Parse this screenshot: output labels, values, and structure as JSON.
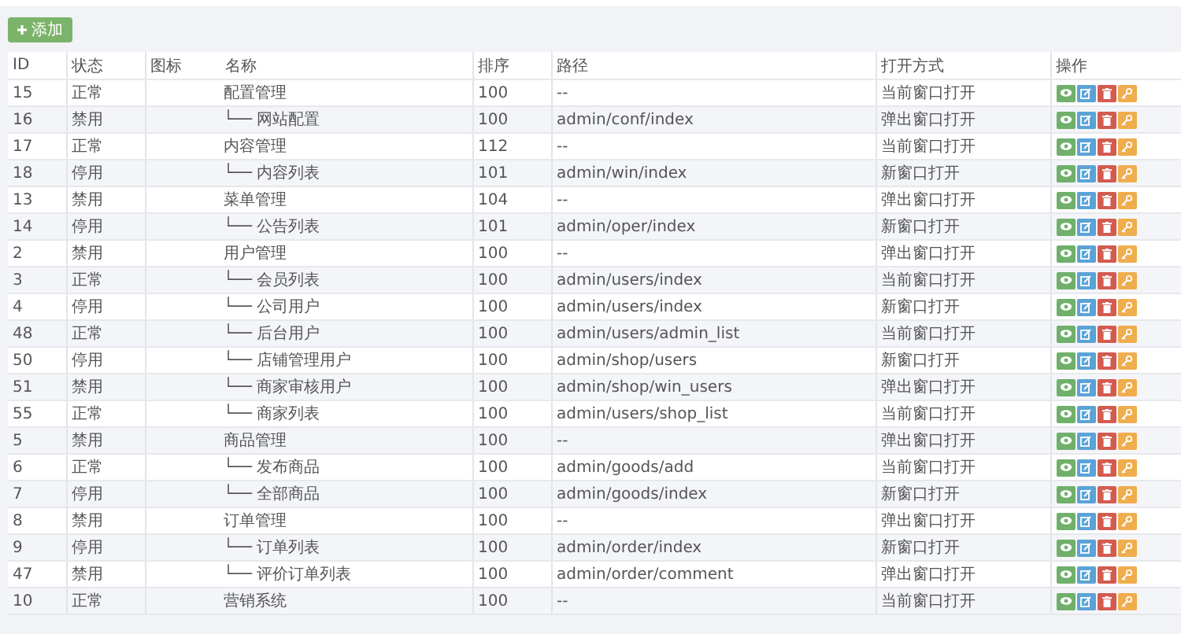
{
  "toolbar": {
    "add_button": "添加"
  },
  "table": {
    "columns": [
      "ID",
      "状态",
      "图标",
      "名称",
      "排序",
      "路径",
      "打开方式",
      "操作"
    ],
    "rows": [
      {
        "id": "15",
        "status": "正常",
        "name": "配置管理",
        "sort": "100",
        "path": "--",
        "open": "当前窗口打开",
        "children": [
          {
            "id": "16",
            "status": "禁用",
            "name": "└── 网站配置",
            "sort": "100",
            "path": "admin/conf/index",
            "open": "弹出窗口打开"
          }
        ]
      },
      {
        "id": "17",
        "status": "正常",
        "name": "内容管理",
        "sort": "112",
        "path": "--",
        "open": "当前窗口打开",
        "children": [
          {
            "id": "18",
            "status": "停用",
            "name": "└── 内容列表",
            "sort": "101",
            "path": "admin/win/index",
            "open": "新窗口打开"
          }
        ]
      },
      {
        "id": "13",
        "status": "禁用",
        "name": "菜单管理",
        "sort": "104",
        "path": "--",
        "open": "弹出窗口打开",
        "children": [
          {
            "id": "14",
            "status": "停用",
            "name": "└── 公告列表",
            "sort": "101",
            "path": "admin/oper/index",
            "open": "新窗口打开"
          }
        ]
      },
      {
        "id": "2",
        "status": "禁用",
        "name": "用户管理",
        "sort": "100",
        "path": "--",
        "open": "弹出窗口打开",
        "children": [
          {
            "id": "3",
            "status": "正常",
            "name": "└── 会员列表",
            "sort": "100",
            "path": "admin/users/index",
            "open": "当前窗口打开"
          },
          {
            "id": "4",
            "status": "停用",
            "name": "└── 公司用户",
            "sort": "100",
            "path": "admin/users/index",
            "open": "新窗口打开"
          },
          {
            "id": "48",
            "status": "正常",
            "name": "└── 后台用户",
            "sort": "100",
            "path": "admin/users/admin_list",
            "open": "当前窗口打开"
          },
          {
            "id": "50",
            "status": "停用",
            "name": "└── 店铺管理用户",
            "sort": "100",
            "path": "admin/shop/users",
            "open": "新窗口打开"
          },
          {
            "id": "51",
            "status": "禁用",
            "name": "└── 商家审核用户",
            "sort": "100",
            "path": "admin/shop/win_users",
            "open": "弹出窗口打开"
          },
          {
            "id": "55",
            "status": "正常",
            "name": "└── 商家列表",
            "sort": "100",
            "path": "admin/users/shop_list",
            "open": "当前窗口打开"
          }
        ]
      },
      {
        "id": "5",
        "status": "禁用",
        "name": "商品管理",
        "sort": "100",
        "path": "--",
        "open": "弹出窗口打开",
        "children": [
          {
            "id": "6",
            "status": "正常",
            "name": "└── 发布商品",
            "sort": "100",
            "path": "admin/goods/add",
            "open": "当前窗口打开"
          },
          {
            "id": "7",
            "status": "停用",
            "name": "└── 全部商品",
            "sort": "100",
            "path": "admin/goods/index",
            "open": "新窗口打开"
          }
        ]
      },
      {
        "id": "8",
        "status": "禁用",
        "name": "订单管理",
        "sort": "100",
        "path": "--",
        "open": "弹出窗口打开",
        "children": [
          {
            "id": "9",
            "status": "停用",
            "name": "└── 订单列表",
            "sort": "100",
            "path": "admin/order/index",
            "open": "新窗口打开"
          },
          {
            "id": "47",
            "status": "禁用",
            "name": "└── 评价订单列表",
            "sort": "100",
            "path": "admin/order/comment",
            "open": "弹出窗口打开"
          }
        ]
      },
      {
        "id": "10",
        "status": "正常",
        "name": "营销系统",
        "sort": "100",
        "path": "--",
        "open": "当前窗口打开"
      }
    ]
  }
}
